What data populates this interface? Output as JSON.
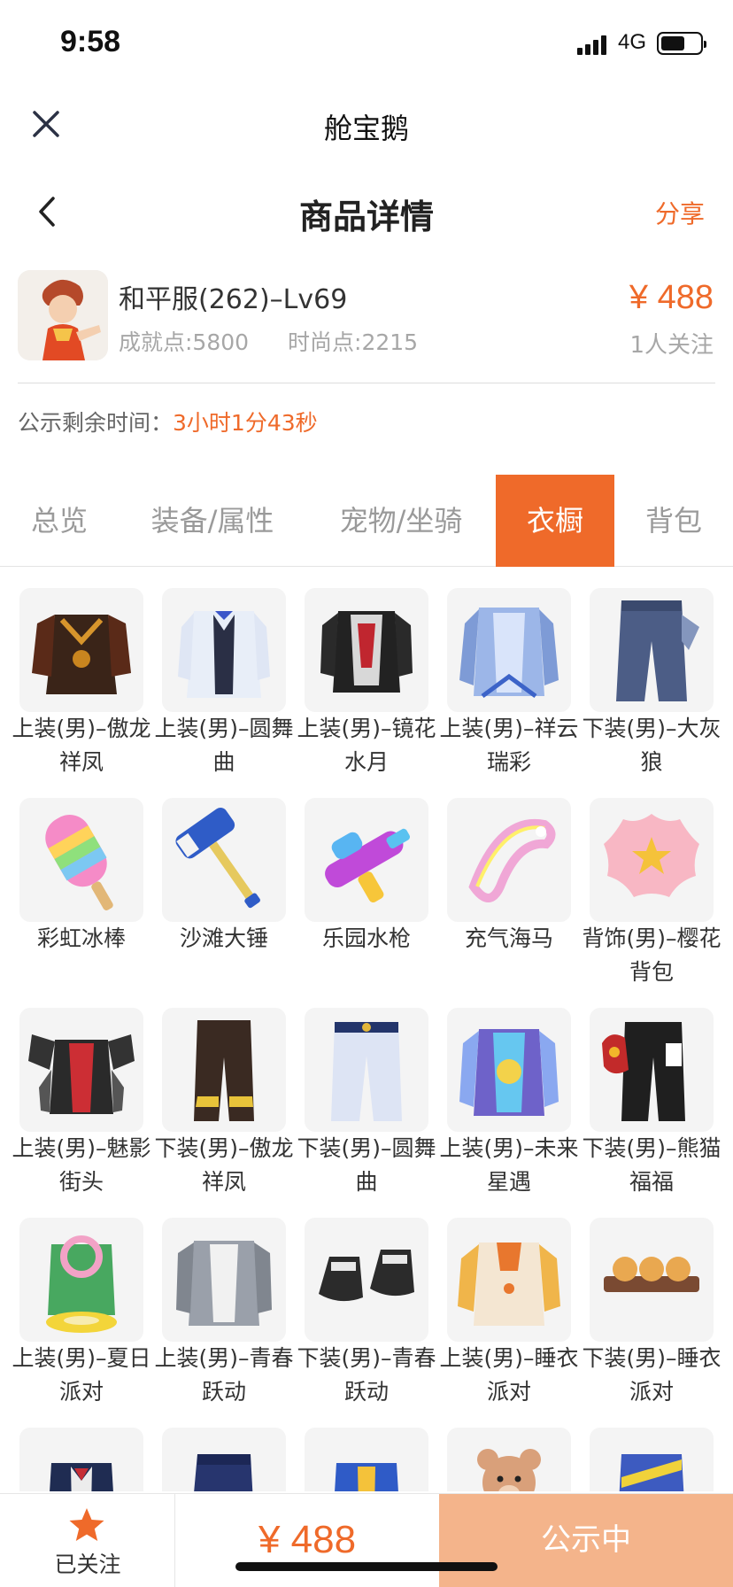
{
  "status_bar": {
    "time": "9:58",
    "network": "4G"
  },
  "app": {
    "title": "舱宝鹅"
  },
  "nav": {
    "title": "商品详情",
    "share_label": "分享"
  },
  "product": {
    "name": "和平服(262)–Lv69",
    "achievement": "成就点:5800",
    "fashion": "时尚点:2215",
    "price": "¥ 488",
    "followers": "1人关注"
  },
  "countdown": {
    "label": "公示剩余时间：",
    "value": "3小时1分43秒"
  },
  "tabs": [
    {
      "label": "总览"
    },
    {
      "label": "装备/属性"
    },
    {
      "label": "宠物/坐骑"
    },
    {
      "label": "衣橱",
      "active": true
    },
    {
      "label": "背包"
    }
  ],
  "items": [
    {
      "label": "上装(男)–傲龙祥凤",
      "icon": "dragon-outfit-top-icon"
    },
    {
      "label": "上装(男)–圆舞曲",
      "icon": "waltz-suit-top-icon"
    },
    {
      "label": "上装(男)–镜花水月",
      "icon": "mirror-flower-top-icon"
    },
    {
      "label": "上装(男)–祥云瑞彩",
      "icon": "auspicious-cloud-top-icon"
    },
    {
      "label": "下装(男)–大灰狼",
      "icon": "grey-wolf-pants-icon"
    },
    {
      "label": "彩虹冰棒",
      "icon": "rainbow-popsicle-icon"
    },
    {
      "label": "沙滩大锤",
      "icon": "beach-hammer-icon"
    },
    {
      "label": "乐园水枪",
      "icon": "water-gun-icon"
    },
    {
      "label": "充气海马",
      "icon": "inflatable-seahorse-icon"
    },
    {
      "label": "背饰(男)–樱花背包",
      "icon": "sakura-backpack-icon"
    },
    {
      "label": "上装(男)–魅影街头",
      "icon": "phantom-street-top-icon"
    },
    {
      "label": "下装(男)–傲龙祥凤",
      "icon": "dragon-pants-icon"
    },
    {
      "label": "下装(男)–圆舞曲",
      "icon": "waltz-pants-icon"
    },
    {
      "label": "上装(男)–未来星遇",
      "icon": "future-star-top-icon"
    },
    {
      "label": "下装(男)–熊猫福福",
      "icon": "panda-pants-icon"
    },
    {
      "label": "上装(男)–夏日派对",
      "icon": "summer-party-top-icon"
    },
    {
      "label": "上装(男)–青春跃动",
      "icon": "youth-top-icon"
    },
    {
      "label": "下装(男)–青春跃动",
      "icon": "youth-shoes-icon"
    },
    {
      "label": "上装(男)–睡衣派对",
      "icon": "pajama-top-icon"
    },
    {
      "label": "下装(男)–睡衣派对",
      "icon": "pajama-slippers-icon"
    },
    {
      "label": "",
      "icon": "navy-suit-icon"
    },
    {
      "label": "",
      "icon": "navy-pants-icon"
    },
    {
      "label": "",
      "icon": "varsity-jacket-icon"
    },
    {
      "label": "",
      "icon": "teddy-bear-icon"
    },
    {
      "label": "",
      "icon": "yellow-belt-pants-icon"
    }
  ],
  "bottom_bar": {
    "follow_label": "已关注",
    "price": "¥ 488",
    "status_label": "公示中"
  },
  "colors": {
    "accent": "#ef6a2a",
    "status_button": "#f4b48b"
  }
}
